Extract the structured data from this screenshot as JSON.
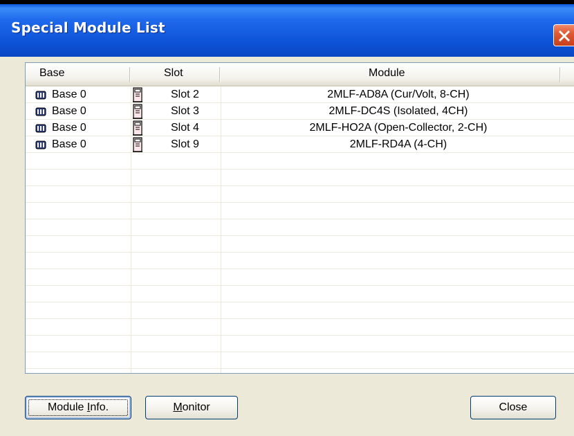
{
  "window": {
    "title": "Special Module List"
  },
  "list": {
    "columns": [
      "Base",
      "Slot",
      "Module"
    ],
    "rows": [
      {
        "base": "Base 0",
        "slot": "Slot 2",
        "module": "2MLF-AD8A (Cur/Volt, 8-CH)"
      },
      {
        "base": "Base 0",
        "slot": "Slot 3",
        "module": "2MLF-DC4S (Isolated, 4CH)"
      },
      {
        "base": "Base 0",
        "slot": "Slot 4",
        "module": "2MLF-HO2A (Open-Collector, 2-CH)"
      },
      {
        "base": "Base 0",
        "slot": "Slot 9",
        "module": "2MLF-RD4A (4-CH)"
      }
    ]
  },
  "buttons": {
    "module_info": {
      "pre": "Module ",
      "accel": "I",
      "post": "nfo."
    },
    "monitor": {
      "pre": "",
      "accel": "M",
      "post": "onitor"
    },
    "close": "Close"
  },
  "colors": {
    "titlebar": "#0a54d8",
    "close_button": "#e05a36",
    "dialog_bg": "#ece9d8"
  },
  "icons": {
    "base": "base-rack-icon",
    "slot": "slot-module-icon",
    "close": "close-icon"
  }
}
